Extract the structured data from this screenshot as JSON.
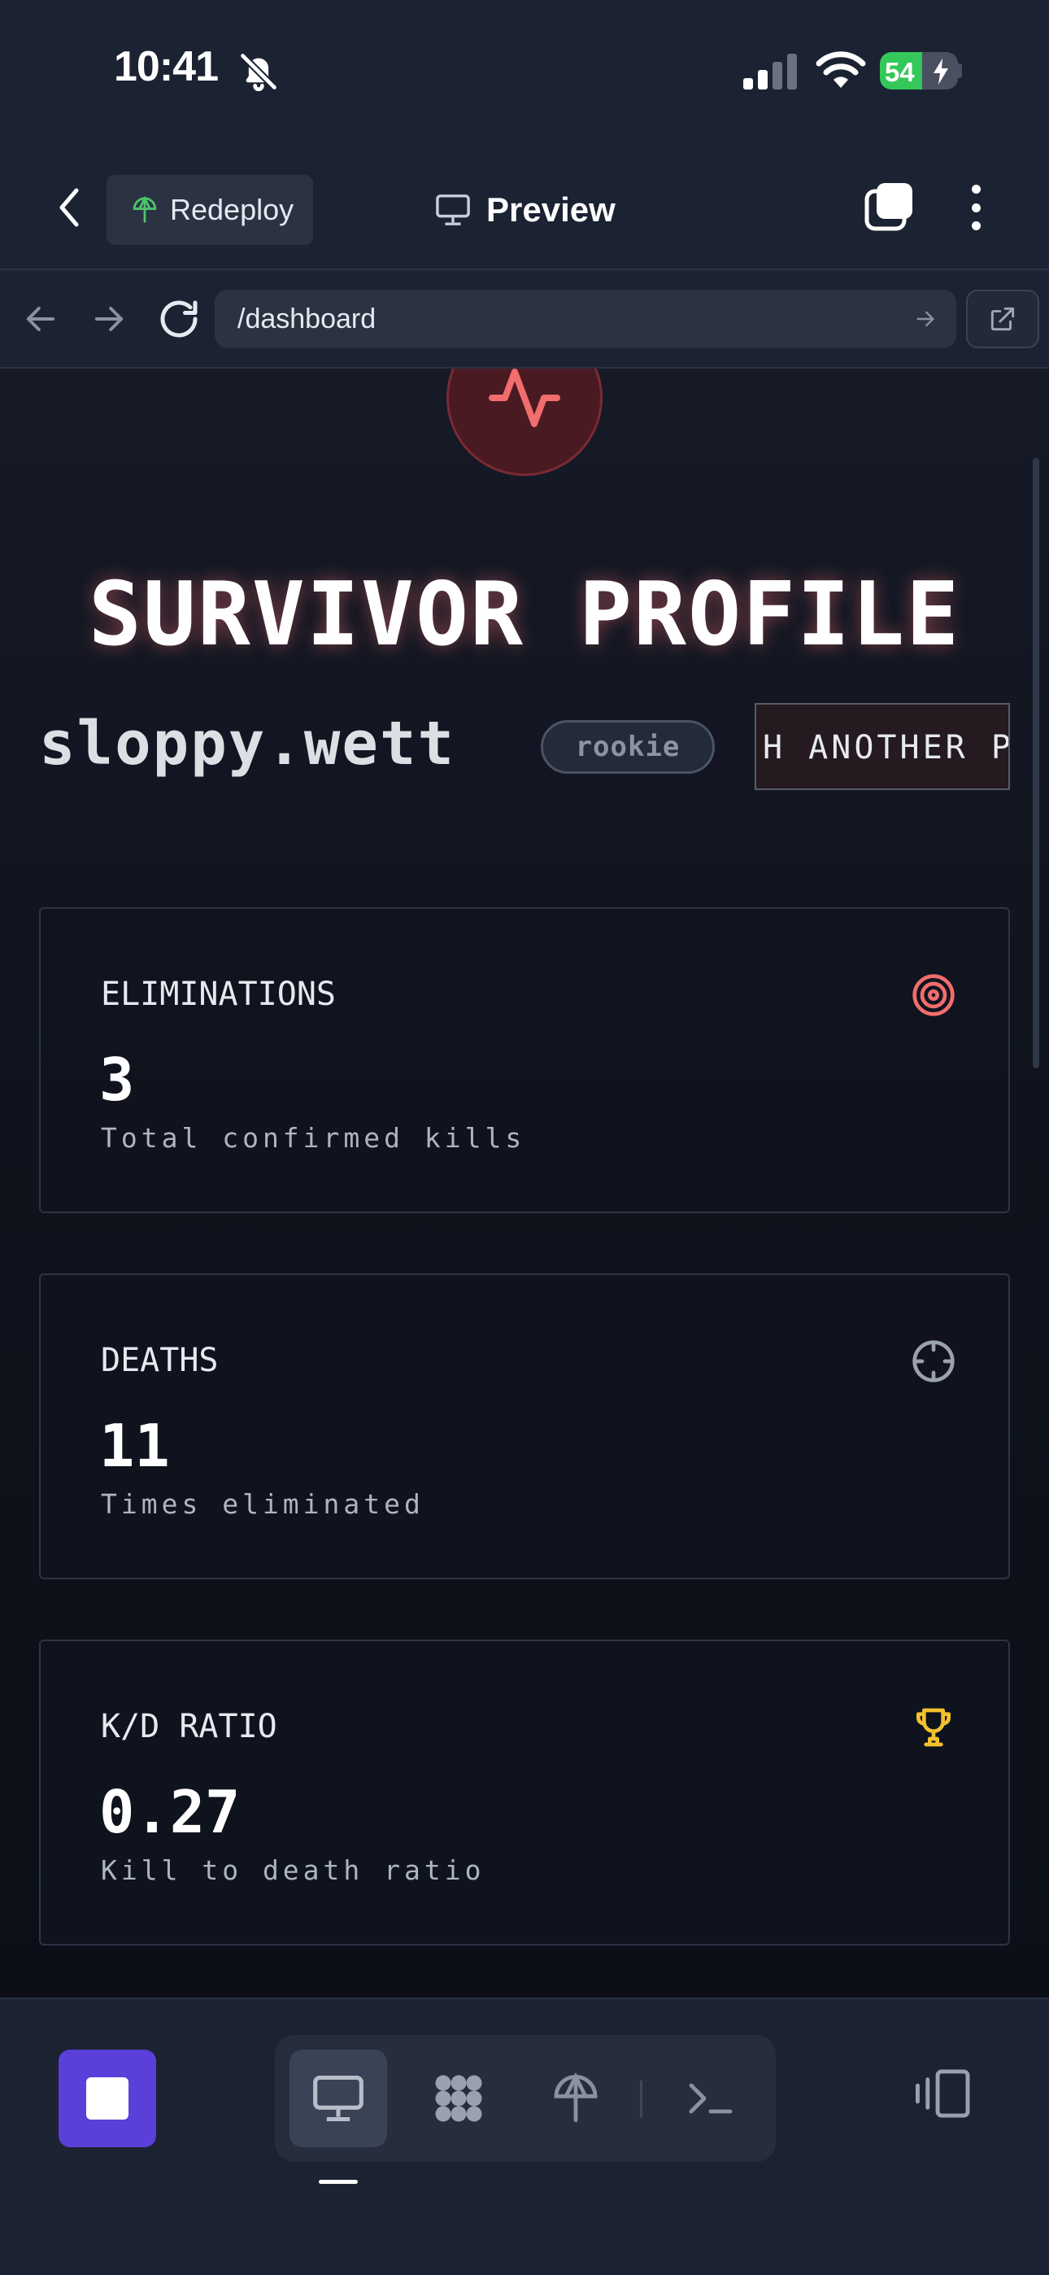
{
  "status_bar": {
    "time": "10:41",
    "battery_percent": "54",
    "battery_level": 0.54
  },
  "header": {
    "redeploy_label": "Redeploy",
    "title": "Preview"
  },
  "url_bar": {
    "url": "/dashboard"
  },
  "profile": {
    "title": "SURVIVOR PROFILE",
    "username": "sloppy.wett",
    "rank": "rookie",
    "ticker_text": "H ANOTHER PL"
  },
  "stats": [
    {
      "label": "ELIMINATIONS",
      "value": "3",
      "caption": "Total confirmed kills",
      "icon": "target-icon",
      "icon_color": "#f26d6d"
    },
    {
      "label": "DEATHS",
      "value": "11",
      "caption": "Times eliminated",
      "icon": "crosshair-icon",
      "icon_color": "#9aa1ae"
    },
    {
      "label": "K/D RATIO",
      "value": "0.27",
      "caption": "Kill to death ratio",
      "icon": "trophy-icon",
      "icon_color": "#f2c12e"
    }
  ],
  "colors": {
    "accent_red": "#f26d6d",
    "stop_button": "#5b3fd9",
    "battery_green": "#34c759"
  }
}
